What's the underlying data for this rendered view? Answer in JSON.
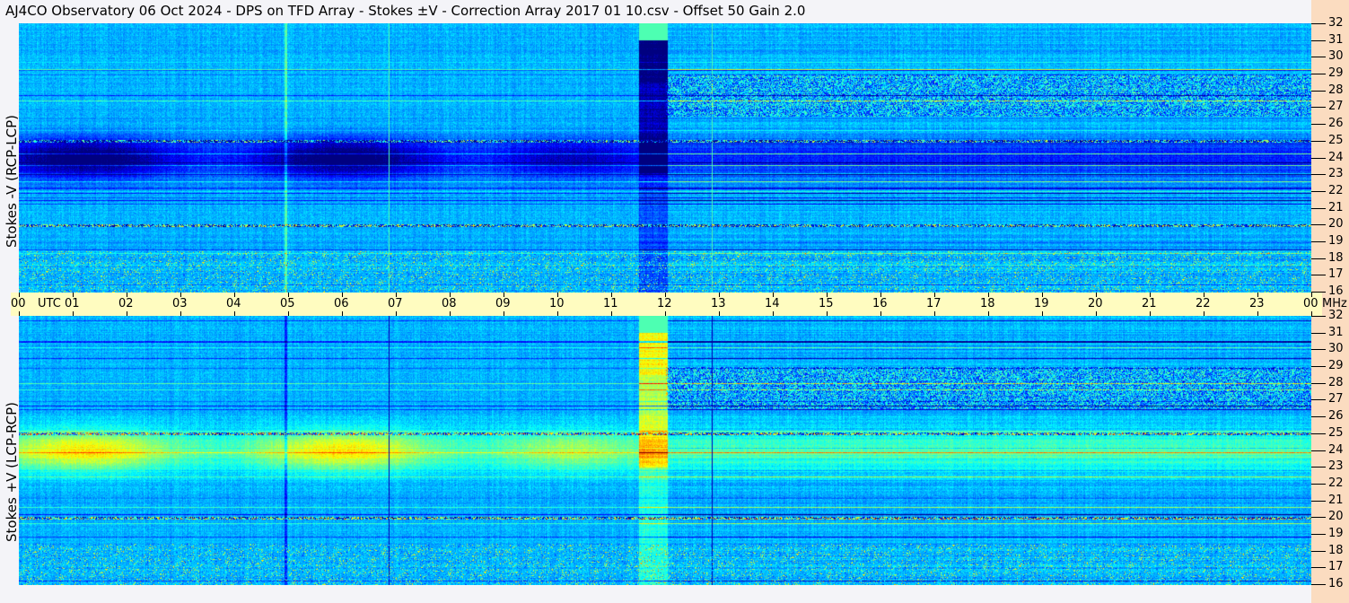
{
  "title": "AJ4CO Observatory  06 Oct 2024  -  DPS on TFD Array  -  Stokes ±V  -  Correction Array 2017 01 10.csv  -  Offset 50  Gain 2.0",
  "colors": {
    "background": "#f4f4f8",
    "time_axis": "#fffcc0",
    "freq_gutter": "#fbdcc0"
  },
  "chart_data": [
    {
      "type": "heatmap",
      "panel": "top",
      "ylabel": "Stokes -V (RCP-LCP)",
      "xlabel": "UTC",
      "ylim": [
        16,
        32
      ],
      "yunit": "MHz",
      "colormap": "jet",
      "yticks": [
        "32",
        "31",
        "30",
        "29",
        "28",
        "27",
        "26",
        "25",
        "24",
        "23",
        "22",
        "21",
        "20",
        "19",
        "18",
        "17",
        "16"
      ]
    },
    {
      "type": "heatmap",
      "panel": "bottom",
      "ylabel": "Stokes +V (LCP-RCP)",
      "xlabel": "UTC",
      "ylim": [
        16,
        32
      ],
      "yunit": "MHz",
      "colormap": "jet",
      "yticks": [
        "32",
        "31",
        "30",
        "29",
        "28",
        "27",
        "26",
        "25",
        "24",
        "23",
        "22",
        "21",
        "20",
        "19",
        "18",
        "17",
        "16"
      ]
    }
  ],
  "time_axis": {
    "unit_label": "UTC",
    "freq_unit": "MHz",
    "ticks": [
      "00",
      "01",
      "02",
      "03",
      "04",
      "05",
      "06",
      "07",
      "08",
      "09",
      "10",
      "11",
      "12",
      "13",
      "14",
      "15",
      "16",
      "17",
      "18",
      "19",
      "20",
      "21",
      "22",
      "23",
      "00"
    ]
  }
}
